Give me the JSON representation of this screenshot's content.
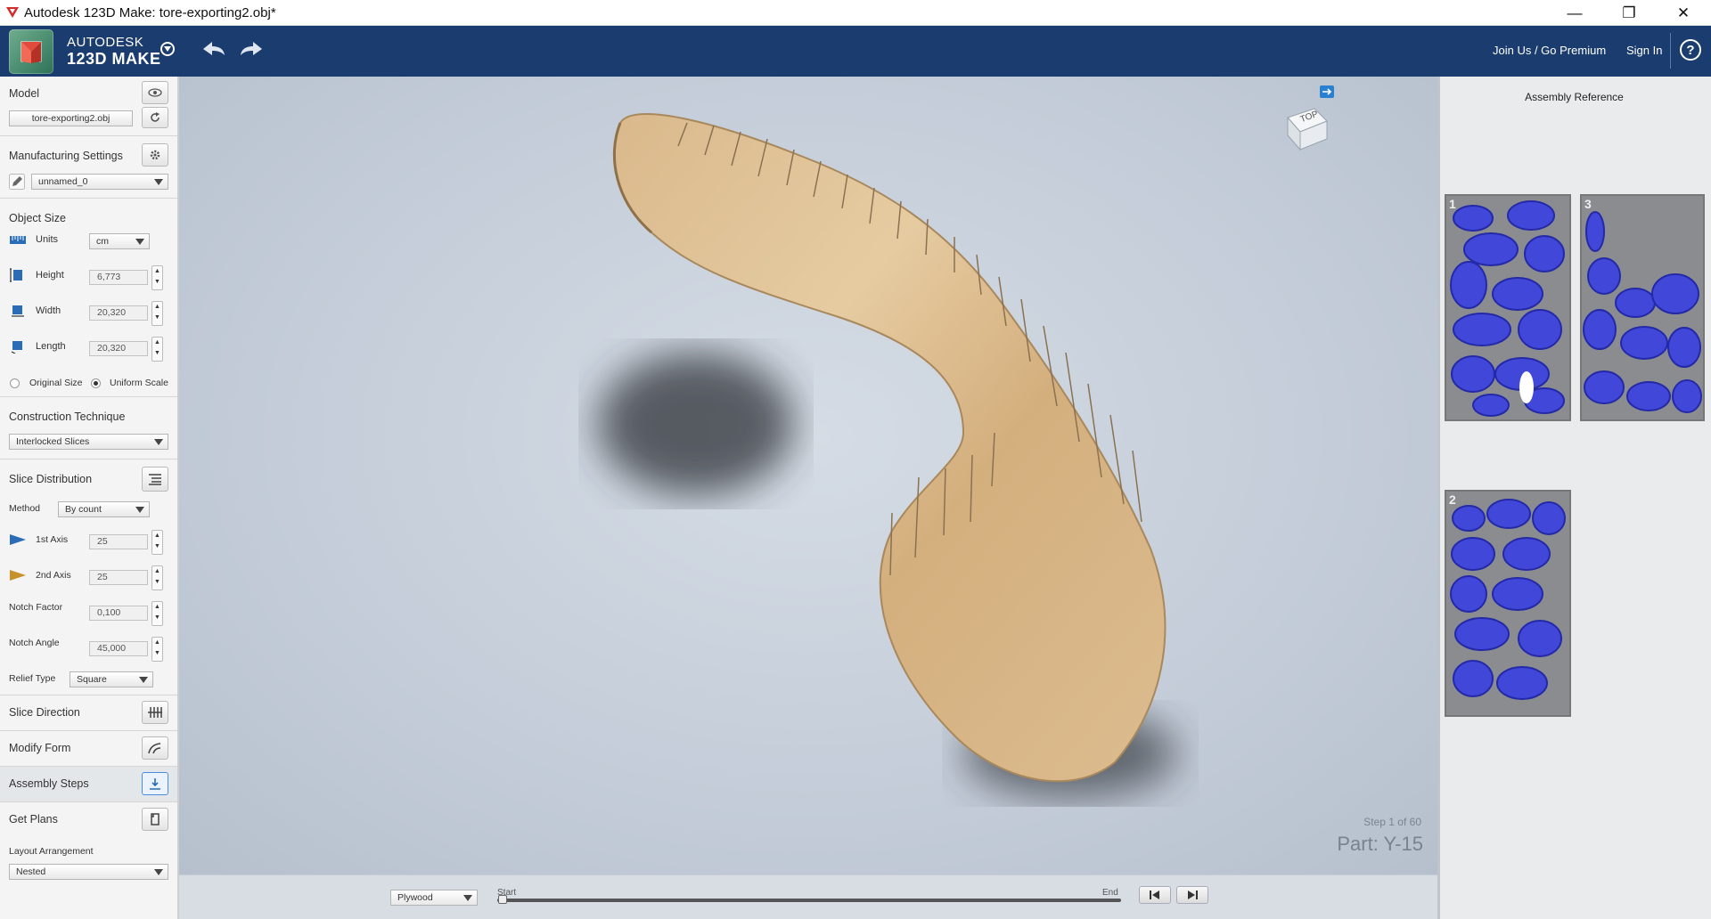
{
  "window": {
    "title": "Autodesk 123D Make: tore-exporting2.obj*",
    "minimize_icon": "—",
    "maximize_icon": "❐",
    "close_icon": "✕"
  },
  "header": {
    "brand_line1": "AUTODESK",
    "brand_line2": "123D MAKE",
    "join_link": "Join Us / Go Premium",
    "signin_link": "Sign In",
    "help_label": "?"
  },
  "left_panel": {
    "model": {
      "title": "Model",
      "file": "tore-exporting2.obj"
    },
    "manufacturing": {
      "title": "Manufacturing Settings",
      "preset": "unnamed_0"
    },
    "object_size": {
      "title": "Object Size",
      "units_label": "Units",
      "units_value": "cm",
      "height_label": "Height",
      "height_value": "6,773",
      "width_label": "Width",
      "width_value": "20,320",
      "length_label": "Length",
      "length_value": "20,320",
      "original_size": "Original Size",
      "uniform_scale": "Uniform Scale"
    },
    "construction": {
      "title": "Construction Technique",
      "value": "Interlocked Slices"
    },
    "slice_distribution": {
      "title": "Slice Distribution",
      "method_label": "Method",
      "method_value": "By count",
      "axis1_label": "1st Axis",
      "axis1_value": "25",
      "axis2_label": "2nd Axis",
      "axis2_value": "25",
      "notch_factor_label": "Notch Factor",
      "notch_factor_value": "0,100",
      "notch_angle_label": "Notch Angle",
      "notch_angle_value": "45,000",
      "relief_label": "Relief Type",
      "relief_value": "Square"
    },
    "slice_direction": "Slice Direction",
    "modify_form": "Modify Form",
    "assembly_steps": "Assembly Steps",
    "get_plans": "Get Plans",
    "layout_label": "Layout Arrangement",
    "layout_value": "Nested"
  },
  "viewport": {
    "view_cube_label": "TOP",
    "step_text": "Step 1 of 60",
    "part_text": "Part: Y-15"
  },
  "bottom_bar": {
    "material": "Plywood",
    "start_label": "Start",
    "end_label": "End"
  },
  "right_panel": {
    "title": "Assembly Reference",
    "sheet1_num": "1",
    "sheet2_num": "3",
    "sheet3_num": "2"
  }
}
